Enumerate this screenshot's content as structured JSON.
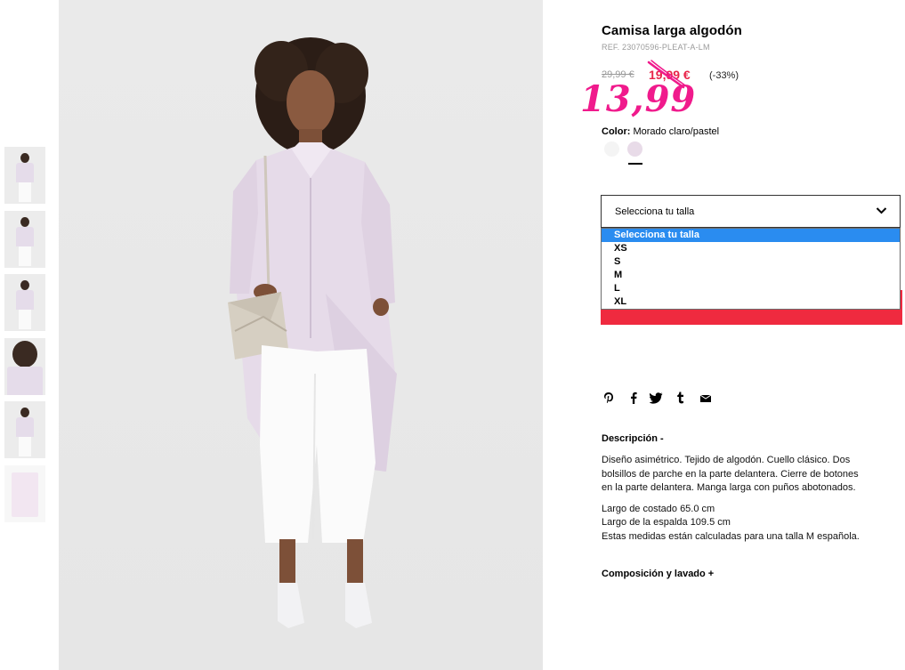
{
  "product": {
    "title": "Camisa larga algodón",
    "ref": "REF. 23070596-PLEAT-A-LM",
    "old_price": "29,99 €",
    "sale_price": "19,99 €",
    "discount": "(-33%)",
    "handwritten_price": "13,99"
  },
  "color": {
    "label": "Color:",
    "value": "Morado claro/pastel",
    "swatches": [
      {
        "name": "white",
        "hex": "#f4f4f4"
      },
      {
        "name": "lilac",
        "hex": "#e8dbe8",
        "selected": true
      }
    ]
  },
  "size_select": {
    "selected": "Selecciona tu talla",
    "options": [
      "Selecciona tu talla",
      "XS",
      "S",
      "M",
      "L",
      "XL"
    ]
  },
  "share_icons": [
    "pinterest-icon",
    "facebook-icon",
    "twitter-icon",
    "tumblr-icon",
    "email-icon"
  ],
  "description": {
    "heading": "Descripción -",
    "paragraph_lines": [
      "Diseño asimétrico. Tejido de algodón. Cuello clásico. Dos",
      "bolsillos de parche en la parte delantera. Cierre de botones",
      "en la parte delantera. Manga larga con puños abotonados."
    ],
    "measurements": [
      "Largo de costado 65.0 cm",
      "Largo de la espalda 109.5 cm",
      "Estas medidas están calculadas para una talla M española."
    ]
  },
  "composition_heading": "Composición y lavado +",
  "colors": {
    "sale_red": "#e8254a",
    "handwritten_pink": "#f01a8c",
    "add_button_red": "#ef2a3f",
    "dropdown_highlight": "#2a8cf0"
  }
}
